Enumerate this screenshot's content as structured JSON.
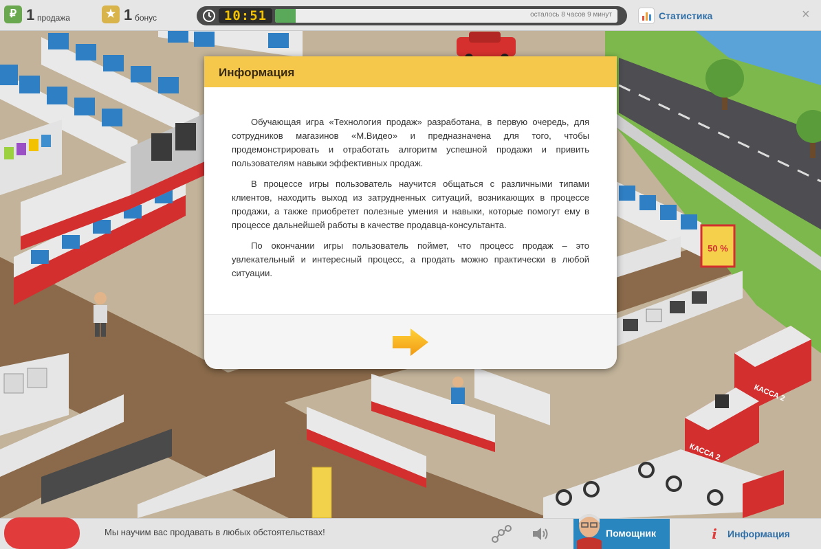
{
  "topbar": {
    "sales_icon": "ruble-icon",
    "sales_count": "1",
    "sales_label": "продажа",
    "bonus_icon": "star-icon",
    "bonus_count": "1",
    "bonus_label": "бонус",
    "timer_display": "10:51",
    "timer_progress": 0.06,
    "timer_remaining_text": "осталось 8 часов 9 минут",
    "stats_label": "Статистика",
    "close_symbol": "×"
  },
  "scene": {
    "sale_badge": "50 %",
    "cash_desk_label_1": "КАССА 2",
    "cash_desk_label_2": "КАССА 2"
  },
  "dialog": {
    "title": "Информация",
    "paragraphs": [
      "Обучающая игра «Технология продаж» разработана, в первую очередь, для сотрудников магазинов «М.Видео» и предназначена для того, чтобы продемонстрировать и отработать алгоритм успешной продажи и привить пользователям навыки эффективных продаж.",
      "В процессе игры пользователь научится общаться с различными типами клиентов, находить выход из затрудненных ситуаций, возникающих в процессе продажи, а также приобретет полезные умения и навыки, которые помогут ему в процессе дальнейшей работы в качестве продавца-консультанта.",
      "По окончании игры пользователь поймет, что процесс продаж – это увлекательный и интересный процесс, а продать можно практически в любой ситуации."
    ],
    "next_icon": "arrow-right-icon"
  },
  "bottombar": {
    "ticker_text": "Мы научим вас продавать в любых обстоятельствах!",
    "assistant_label": "Помощник",
    "info_label": "Информация"
  },
  "colors": {
    "dialog_header": "#f5c74b",
    "accent_blue": "#2f6fa8",
    "menu_red": "#e23b3b",
    "timer_green": "#5aa95b"
  }
}
